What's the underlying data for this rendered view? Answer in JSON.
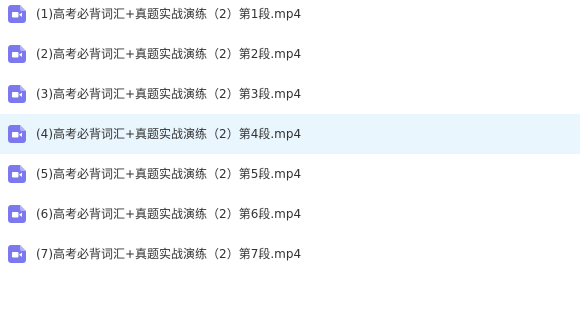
{
  "file_list": {
    "selected_index": 3,
    "icon": "video-file-icon",
    "icon_color": "#7c79ef",
    "selected_bg": "#e9f6fd",
    "items": [
      {
        "name": "(1)高考必背词汇+真题实战演练（2）第1段.mp4"
      },
      {
        "name": "(2)高考必背词汇+真题实战演练（2）第2段.mp4"
      },
      {
        "name": "(3)高考必背词汇+真题实战演练（2）第3段.mp4"
      },
      {
        "name": "(4)高考必背词汇+真题实战演练（2）第4段.mp4"
      },
      {
        "name": "(5)高考必背词汇+真题实战演练（2）第5段.mp4"
      },
      {
        "name": "(6)高考必背词汇+真题实战演练（2）第6段.mp4"
      },
      {
        "name": "(7)高考必背词汇+真题实战演练（2）第7段.mp4"
      }
    ]
  }
}
